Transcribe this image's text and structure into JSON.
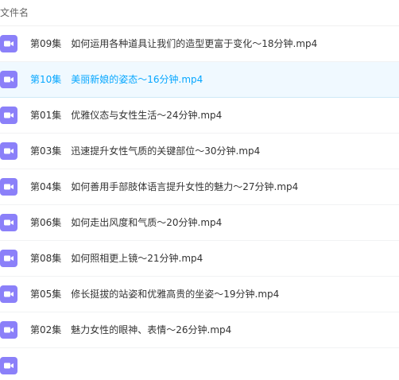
{
  "header": {
    "column_filename": "文件名"
  },
  "files": [
    {
      "episode": "第09集",
      "title": "如何运用各种道具让我们的造型更富于变化～18分钟.mp4",
      "selected": false
    },
    {
      "episode": "第10集",
      "title": "美丽新娘的姿态～16分钟.mp4",
      "selected": true
    },
    {
      "episode": "第01集",
      "title": "优雅仪态与女性生活～24分钟.mp4",
      "selected": false
    },
    {
      "episode": "第03集",
      "title": "迅速提升女性气质的关键部位～30分钟.mp4",
      "selected": false
    },
    {
      "episode": "第04集",
      "title": "如何善用手部肢体语言提升女性的魅力～27分钟.mp4",
      "selected": false
    },
    {
      "episode": "第06集",
      "title": "如何走出风度和气质～20分钟.mp4",
      "selected": false
    },
    {
      "episode": "第08集",
      "title": "如何照相更上镜～21分钟.mp4",
      "selected": false
    },
    {
      "episode": "第05集",
      "title": "修长挺拔的站姿和优雅高贵的坐姿～19分钟.mp4",
      "selected": false
    },
    {
      "episode": "第02集",
      "title": "魅力女性的眼神、表情～26分钟.mp4",
      "selected": false
    }
  ],
  "icon": {
    "name": "video-file-icon",
    "color": "#8b80f9"
  }
}
